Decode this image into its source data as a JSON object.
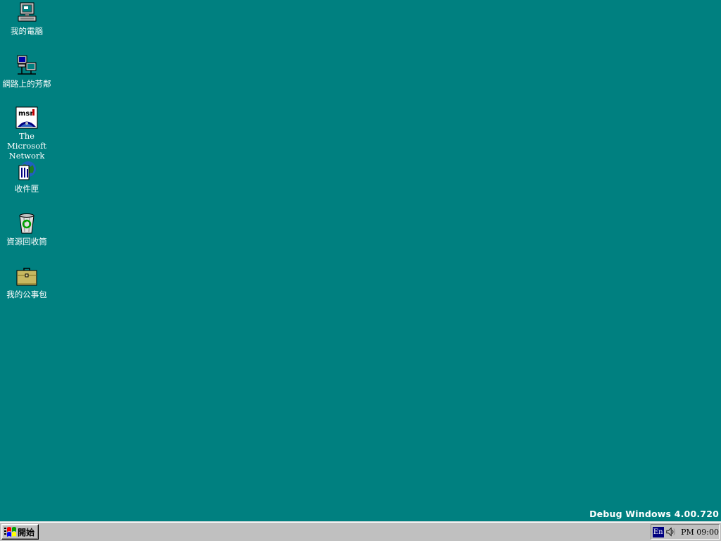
{
  "desktop": {
    "background_color": "#008080",
    "icons": [
      {
        "label": "我的電腦",
        "icon": "my-computer-icon"
      },
      {
        "label": "網路上的芳鄰",
        "icon": "network-neighborhood-icon"
      },
      {
        "label": "The Microsoft Network",
        "icon": "msn-icon"
      },
      {
        "label": "收件匣",
        "icon": "inbox-icon"
      },
      {
        "label": "資源回收筒",
        "icon": "recycle-bin-icon"
      },
      {
        "label": "我的公事包",
        "icon": "briefcase-icon"
      }
    ],
    "version_text": "Debug Windows 4.00.720"
  },
  "taskbar": {
    "start_label": "開始",
    "tray": {
      "language": "En",
      "clock": "PM 09:00"
    }
  }
}
